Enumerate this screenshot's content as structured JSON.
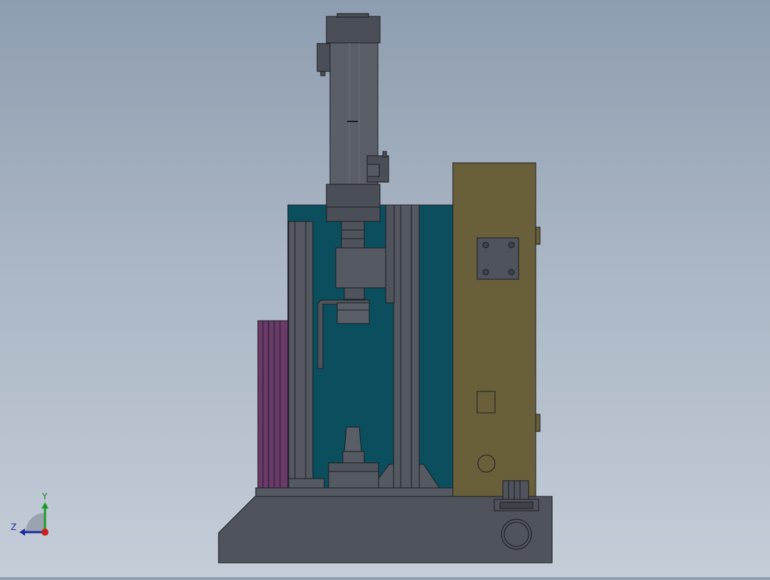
{
  "viewport": {
    "description_label": "",
    "colors": {
      "background_top": "#8e9db0",
      "background_bottom": "#c4cdd8",
      "steel": "#4f535c",
      "steel_dark": "#3e424a",
      "panel_teal": "#0b4f5e",
      "panel_olive": "#6a5f3b",
      "panel_magenta": "#6a3a68",
      "outline": "#1a1c20"
    }
  },
  "triad": {
    "y_label": "Y",
    "z_label": "Z",
    "icons": [
      "axis-triad-icon",
      "y-arrow-icon",
      "z-arrow-icon",
      "x-dot-icon"
    ]
  }
}
